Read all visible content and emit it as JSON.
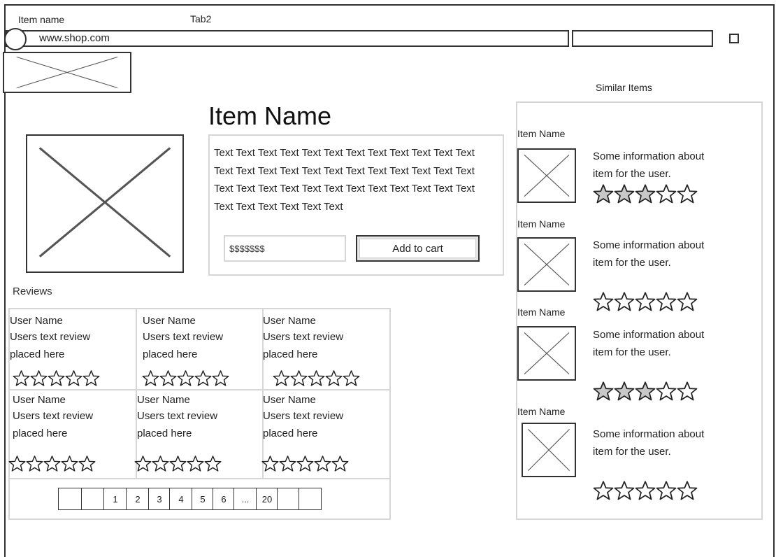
{
  "browser": {
    "tabs": [
      {
        "label": "Item name"
      },
      {
        "label": "Tab2"
      }
    ],
    "address": "www.shop.com",
    "search_value": ""
  },
  "product": {
    "title": "Item Name",
    "description": "Text Text Text Text Text Text Text Text Text Text Text Text Text Text Text Text Text Text Text Text Text Text Text Text Text Text Text Text Text Text Text Text Text Text Text Text Text Text Text Text Text Text",
    "price": "$$$$$$$",
    "add_to_cart_label": "Add to cart"
  },
  "reviews": {
    "title": "Reviews",
    "items": [
      {
        "user": "User Name",
        "line1": "Users text review",
        "line2": "placed here",
        "rating": 0
      },
      {
        "user": "User Name",
        "line1": "Users text review",
        "line2": "placed here",
        "rating": 0
      },
      {
        "user": "User Name",
        "line1": "Users text review",
        "line2": "placed here",
        "rating": 0
      },
      {
        "user": "User Name",
        "line1": "Users text review",
        "line2": "placed here",
        "rating": 0
      },
      {
        "user": "User Name",
        "line1": "Users text review",
        "line2": "placed here",
        "rating": 0
      },
      {
        "user": "User Name",
        "line1": "Users text review",
        "line2": "placed here",
        "rating": 0
      }
    ],
    "pagination": [
      "",
      "",
      "1",
      "2",
      "3",
      "4",
      "5",
      "6",
      "...",
      "20",
      "",
      ""
    ]
  },
  "similar": {
    "title": "Similar Items",
    "items": [
      {
        "name": "Item Name",
        "line1": "Some information about",
        "line2": "item for the user.",
        "rating": 3
      },
      {
        "name": "Item Name",
        "line1": "Some information about",
        "line2": "item for the user.",
        "rating": 0
      },
      {
        "name": "Item Name",
        "line1": "Some information about",
        "line2": "item for the user.",
        "rating": 3
      },
      {
        "name": "Item Name",
        "line1": "Some information about",
        "line2": "item for the user.",
        "rating": 0
      }
    ]
  },
  "colors": {
    "border": "#333333",
    "light_border": "#d6d6d6",
    "star_fill": "#c8c8c8"
  }
}
